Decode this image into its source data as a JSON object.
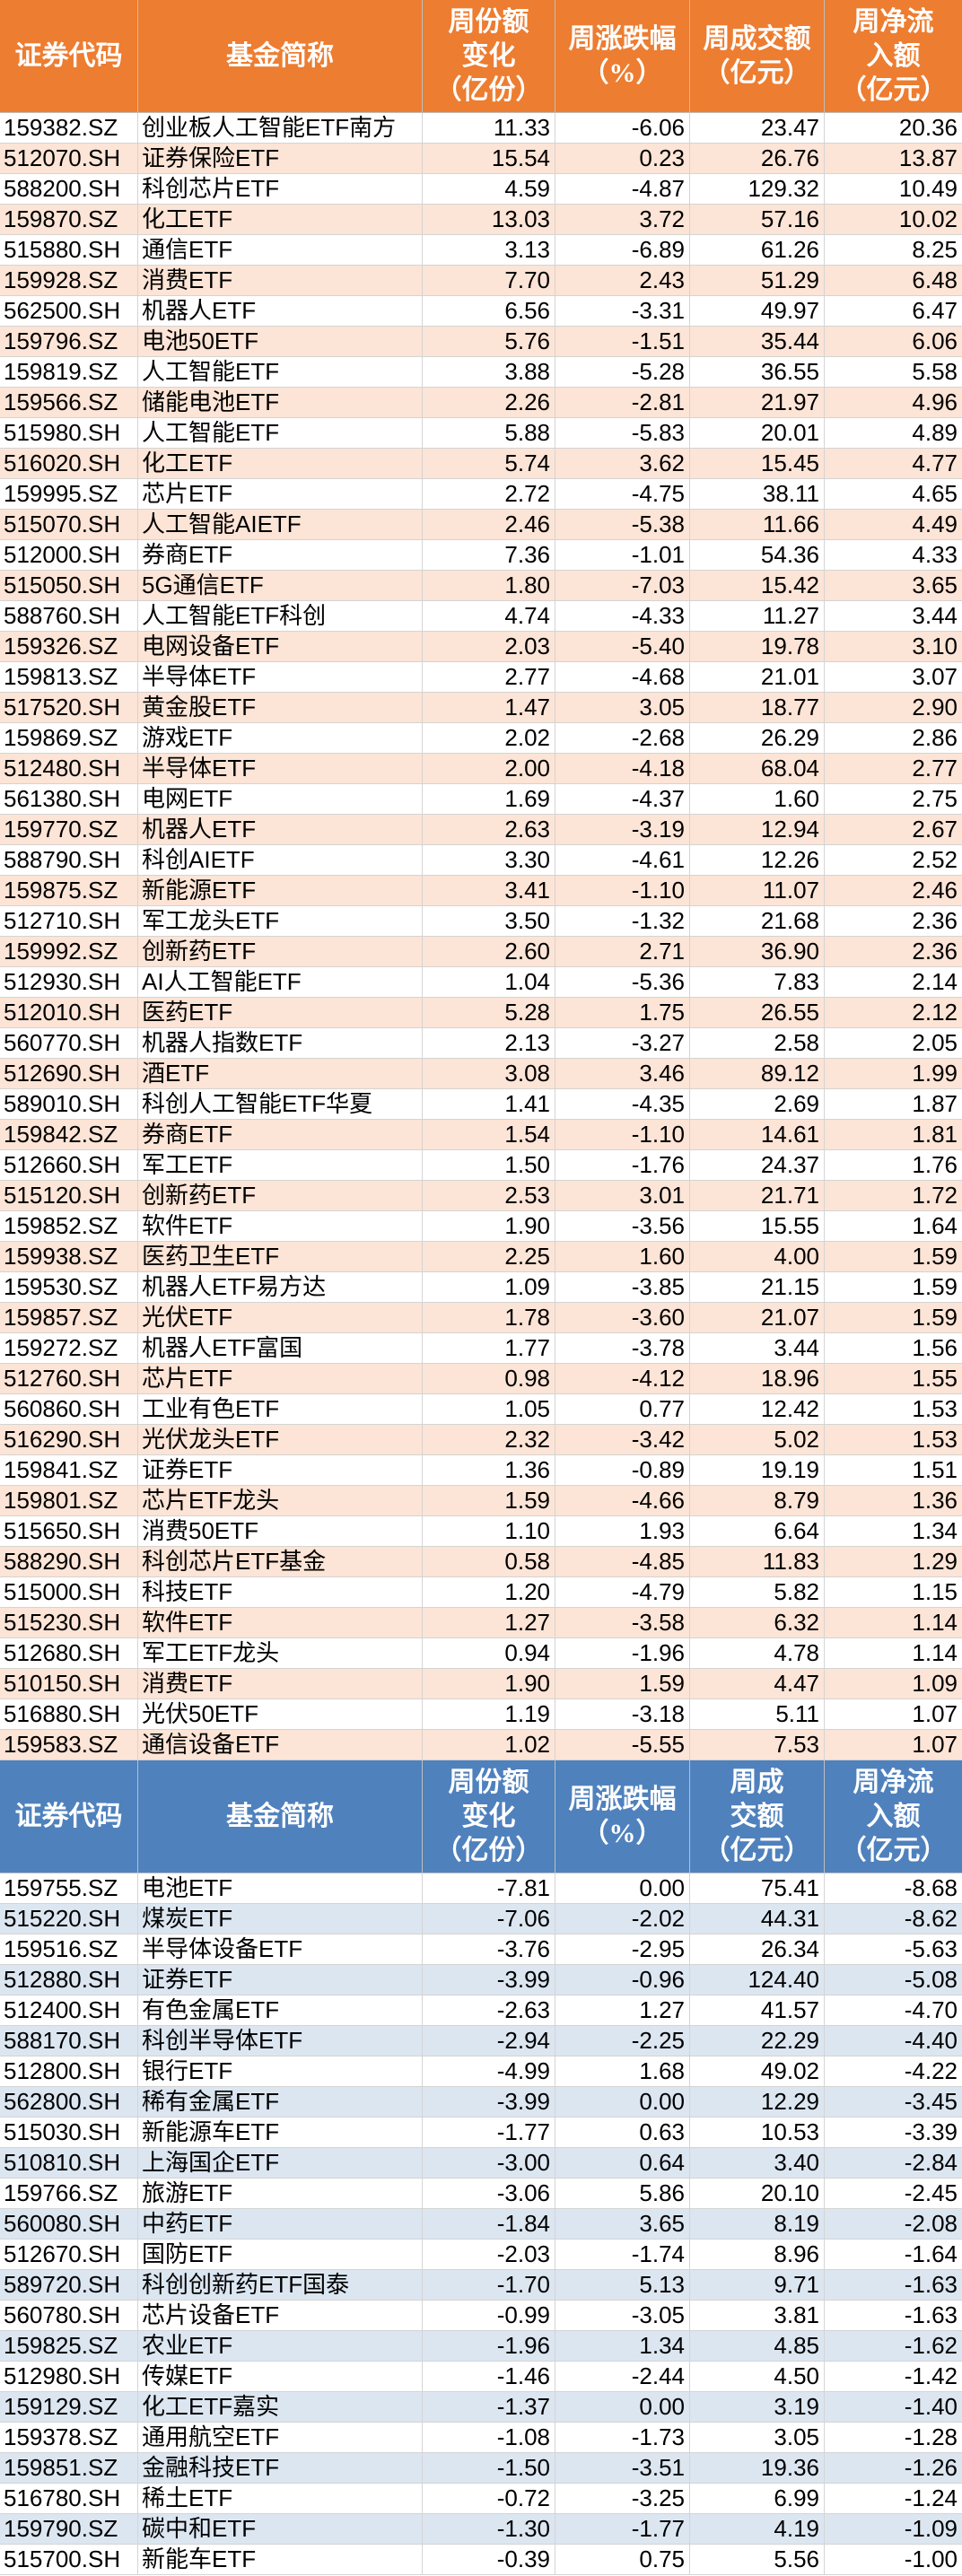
{
  "colors": {
    "inflow_header": "#ed7d31",
    "inflow_band": "#fce4d6",
    "outflow_header": "#4f81bd",
    "outflow_band": "#dce6f1",
    "header_text": "#ffffff",
    "cell_text": "#000000"
  },
  "chart_data": [
    {
      "type": "table",
      "columns": [
        [
          "证券代码"
        ],
        [
          "基金简称"
        ],
        [
          "周份额",
          "变化",
          "（亿份）"
        ],
        [
          "周涨跌幅",
          "（%）"
        ],
        [
          "周成交额",
          "（亿元）"
        ],
        [
          "周净流",
          "入额",
          "（亿元）"
        ]
      ],
      "rows": [
        [
          "159382.SZ",
          "创业板人工智能ETF南方",
          "11.33",
          "-6.06",
          "23.47",
          "20.36"
        ],
        [
          "512070.SH",
          "证券保险ETF",
          "15.54",
          "0.23",
          "26.76",
          "13.87"
        ],
        [
          "588200.SH",
          "科创芯片ETF",
          "4.59",
          "-4.87",
          "129.32",
          "10.49"
        ],
        [
          "159870.SZ",
          "化工ETF",
          "13.03",
          "3.72",
          "57.16",
          "10.02"
        ],
        [
          "515880.SH",
          "通信ETF",
          "3.13",
          "-6.89",
          "61.26",
          "8.25"
        ],
        [
          "159928.SZ",
          "消费ETF",
          "7.70",
          "2.43",
          "51.29",
          "6.48"
        ],
        [
          "562500.SH",
          "机器人ETF",
          "6.56",
          "-3.31",
          "49.97",
          "6.47"
        ],
        [
          "159796.SZ",
          "电池50ETF",
          "5.76",
          "-1.51",
          "35.44",
          "6.06"
        ],
        [
          "159819.SZ",
          "人工智能ETF",
          "3.88",
          "-5.28",
          "36.55",
          "5.58"
        ],
        [
          "159566.SZ",
          "储能电池ETF",
          "2.26",
          "-2.81",
          "21.97",
          "4.96"
        ],
        [
          "515980.SH",
          "人工智能ETF",
          "5.88",
          "-5.83",
          "20.01",
          "4.89"
        ],
        [
          "516020.SH",
          "化工ETF",
          "5.74",
          "3.62",
          "15.45",
          "4.77"
        ],
        [
          "159995.SZ",
          "芯片ETF",
          "2.72",
          "-4.75",
          "38.11",
          "4.65"
        ],
        [
          "515070.SH",
          "人工智能AIETF",
          "2.46",
          "-5.38",
          "11.66",
          "4.49"
        ],
        [
          "512000.SH",
          "券商ETF",
          "7.36",
          "-1.01",
          "54.36",
          "4.33"
        ],
        [
          "515050.SH",
          "5G通信ETF",
          "1.80",
          "-7.03",
          "15.42",
          "3.65"
        ],
        [
          "588760.SH",
          "人工智能ETF科创",
          "4.74",
          "-4.33",
          "11.27",
          "3.44"
        ],
        [
          "159326.SZ",
          "电网设备ETF",
          "2.03",
          "-5.40",
          "19.78",
          "3.10"
        ],
        [
          "159813.SZ",
          "半导体ETF",
          "2.77",
          "-4.68",
          "21.01",
          "3.07"
        ],
        [
          "517520.SH",
          "黄金股ETF",
          "1.47",
          "3.05",
          "18.77",
          "2.90"
        ],
        [
          "159869.SZ",
          "游戏ETF",
          "2.02",
          "-2.68",
          "26.29",
          "2.86"
        ],
        [
          "512480.SH",
          "半导体ETF",
          "2.00",
          "-4.18",
          "68.04",
          "2.77"
        ],
        [
          "561380.SH",
          "电网ETF",
          "1.69",
          "-4.37",
          "1.60",
          "2.75"
        ],
        [
          "159770.SZ",
          "机器人ETF",
          "2.63",
          "-3.19",
          "12.94",
          "2.67"
        ],
        [
          "588790.SH",
          "科创AIETF",
          "3.30",
          "-4.61",
          "12.26",
          "2.52"
        ],
        [
          "159875.SZ",
          "新能源ETF",
          "3.41",
          "-1.10",
          "11.07",
          "2.46"
        ],
        [
          "512710.SH",
          "军工龙头ETF",
          "3.50",
          "-1.32",
          "21.68",
          "2.36"
        ],
        [
          "159992.SZ",
          "创新药ETF",
          "2.60",
          "2.71",
          "36.90",
          "2.36"
        ],
        [
          "512930.SH",
          "AI人工智能ETF",
          "1.04",
          "-5.36",
          "7.83",
          "2.14"
        ],
        [
          "512010.SH",
          "医药ETF",
          "5.28",
          "1.75",
          "26.55",
          "2.12"
        ],
        [
          "560770.SH",
          "机器人指数ETF",
          "2.13",
          "-3.27",
          "2.58",
          "2.05"
        ],
        [
          "512690.SH",
          "酒ETF",
          "3.08",
          "3.46",
          "89.12",
          "1.99"
        ],
        [
          "589010.SH",
          "科创人工智能ETF华夏",
          "1.41",
          "-4.35",
          "2.69",
          "1.87"
        ],
        [
          "159842.SZ",
          "券商ETF",
          "1.54",
          "-1.10",
          "14.61",
          "1.81"
        ],
        [
          "512660.SH",
          "军工ETF",
          "1.50",
          "-1.76",
          "24.37",
          "1.76"
        ],
        [
          "515120.SH",
          "创新药ETF",
          "2.53",
          "3.01",
          "21.71",
          "1.72"
        ],
        [
          "159852.SZ",
          "软件ETF",
          "1.90",
          "-3.56",
          "15.55",
          "1.64"
        ],
        [
          "159938.SZ",
          "医药卫生ETF",
          "2.25",
          "1.60",
          "4.00",
          "1.59"
        ],
        [
          "159530.SZ",
          "机器人ETF易方达",
          "1.09",
          "-3.85",
          "21.15",
          "1.59"
        ],
        [
          "159857.SZ",
          "光伏ETF",
          "1.78",
          "-3.60",
          "21.07",
          "1.59"
        ],
        [
          "159272.SZ",
          "机器人ETF富国",
          "1.77",
          "-3.78",
          "3.44",
          "1.56"
        ],
        [
          "512760.SH",
          "芯片ETF",
          "0.98",
          "-4.12",
          "18.96",
          "1.55"
        ],
        [
          "560860.SH",
          "工业有色ETF",
          "1.05",
          "0.77",
          "12.42",
          "1.53"
        ],
        [
          "516290.SH",
          "光伏龙头ETF",
          "2.32",
          "-3.42",
          "5.02",
          "1.53"
        ],
        [
          "159841.SZ",
          "证券ETF",
          "1.36",
          "-0.89",
          "19.19",
          "1.51"
        ],
        [
          "159801.SZ",
          "芯片ETF龙头",
          "1.59",
          "-4.66",
          "8.79",
          "1.36"
        ],
        [
          "515650.SH",
          "消费50ETF",
          "1.10",
          "1.93",
          "6.64",
          "1.34"
        ],
        [
          "588290.SH",
          "科创芯片ETF基金",
          "0.58",
          "-4.85",
          "11.83",
          "1.29"
        ],
        [
          "515000.SH",
          "科技ETF",
          "1.20",
          "-4.79",
          "5.82",
          "1.15"
        ],
        [
          "515230.SH",
          "软件ETF",
          "1.27",
          "-3.58",
          "6.32",
          "1.14"
        ],
        [
          "512680.SH",
          "军工ETF龙头",
          "0.94",
          "-1.96",
          "4.78",
          "1.14"
        ],
        [
          "510150.SH",
          "消费ETF",
          "1.90",
          "1.59",
          "4.47",
          "1.09"
        ],
        [
          "516880.SH",
          "光伏50ETF",
          "1.19",
          "-3.18",
          "5.11",
          "1.07"
        ],
        [
          "159583.SZ",
          "通信设备ETF",
          "1.02",
          "-5.55",
          "7.53",
          "1.07"
        ]
      ]
    },
    {
      "type": "table",
      "columns": [
        [
          "证券代码"
        ],
        [
          "基金简称"
        ],
        [
          "周份额",
          "变化",
          "（亿份）"
        ],
        [
          "周涨跌幅",
          "（%）"
        ],
        [
          "周成",
          "交额",
          "（亿元）"
        ],
        [
          "周净流",
          "入额",
          "（亿元）"
        ]
      ],
      "rows": [
        [
          "159755.SZ",
          "电池ETF",
          "-7.81",
          "0.00",
          "75.41",
          "-8.68"
        ],
        [
          "515220.SH",
          "煤炭ETF",
          "-7.06",
          "-2.02",
          "44.31",
          "-8.62"
        ],
        [
          "159516.SZ",
          "半导体设备ETF",
          "-3.76",
          "-2.95",
          "26.34",
          "-5.63"
        ],
        [
          "512880.SH",
          "证券ETF",
          "-3.99",
          "-0.96",
          "124.40",
          "-5.08"
        ],
        [
          "512400.SH",
          "有色金属ETF",
          "-2.63",
          "1.27",
          "41.57",
          "-4.70"
        ],
        [
          "588170.SH",
          "科创半导体ETF",
          "-2.94",
          "-2.25",
          "22.29",
          "-4.40"
        ],
        [
          "512800.SH",
          "银行ETF",
          "-4.99",
          "1.68",
          "49.02",
          "-4.22"
        ],
        [
          "562800.SH",
          "稀有金属ETF",
          "-3.99",
          "0.00",
          "12.29",
          "-3.45"
        ],
        [
          "515030.SH",
          "新能源车ETF",
          "-1.77",
          "0.63",
          "10.53",
          "-3.39"
        ],
        [
          "510810.SH",
          "上海国企ETF",
          "-3.00",
          "0.64",
          "3.40",
          "-2.84"
        ],
        [
          "159766.SZ",
          "旅游ETF",
          "-3.06",
          "5.86",
          "20.10",
          "-2.45"
        ],
        [
          "560080.SH",
          "中药ETF",
          "-1.84",
          "3.65",
          "8.19",
          "-2.08"
        ],
        [
          "512670.SH",
          "国防ETF",
          "-2.03",
          "-1.74",
          "8.96",
          "-1.64"
        ],
        [
          "589720.SH",
          "科创创新药ETF国泰",
          "-1.70",
          "5.13",
          "9.71",
          "-1.63"
        ],
        [
          "560780.SH",
          "芯片设备ETF",
          "-0.99",
          "-3.05",
          "3.81",
          "-1.63"
        ],
        [
          "159825.SZ",
          "农业ETF",
          "-1.96",
          "1.34",
          "4.85",
          "-1.62"
        ],
        [
          "512980.SH",
          "传媒ETF",
          "-1.46",
          "-2.44",
          "4.50",
          "-1.42"
        ],
        [
          "159129.SZ",
          "化工ETF嘉实",
          "-1.37",
          "0.00",
          "3.19",
          "-1.40"
        ],
        [
          "159378.SZ",
          "通用航空ETF",
          "-1.08",
          "-1.73",
          "3.05",
          "-1.28"
        ],
        [
          "159851.SZ",
          "金融科技ETF",
          "-1.50",
          "-3.51",
          "19.36",
          "-1.26"
        ],
        [
          "516780.SH",
          "稀土ETF",
          "-0.72",
          "-3.25",
          "6.99",
          "-1.24"
        ],
        [
          "159790.SZ",
          "碳中和ETF",
          "-1.30",
          "-1.77",
          "4.19",
          "-1.09"
        ],
        [
          "515700.SH",
          "新能车ETF",
          "-0.39",
          "0.75",
          "5.56",
          "-1.00"
        ]
      ]
    }
  ]
}
